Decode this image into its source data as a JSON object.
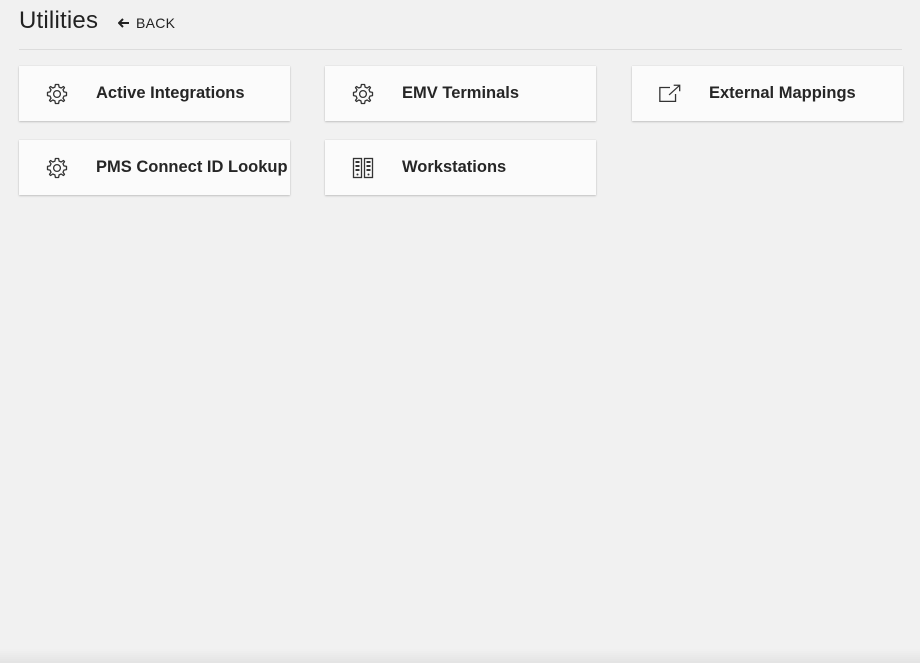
{
  "header": {
    "title": "Utilities",
    "back_label": "BACK"
  },
  "tiles": [
    {
      "label": "Active Integrations",
      "icon": "gear-icon"
    },
    {
      "label": "EMV Terminals",
      "icon": "gear-icon"
    },
    {
      "label": "External Mappings",
      "icon": "external-link-icon"
    },
    {
      "label": "PMS Connect ID Lookup",
      "icon": "gear-icon"
    },
    {
      "label": "Workstations",
      "icon": "workstations-icon"
    }
  ],
  "colors": {
    "background": "#f1f1f1",
    "tile": "#fbfbfb",
    "text": "#222222"
  }
}
